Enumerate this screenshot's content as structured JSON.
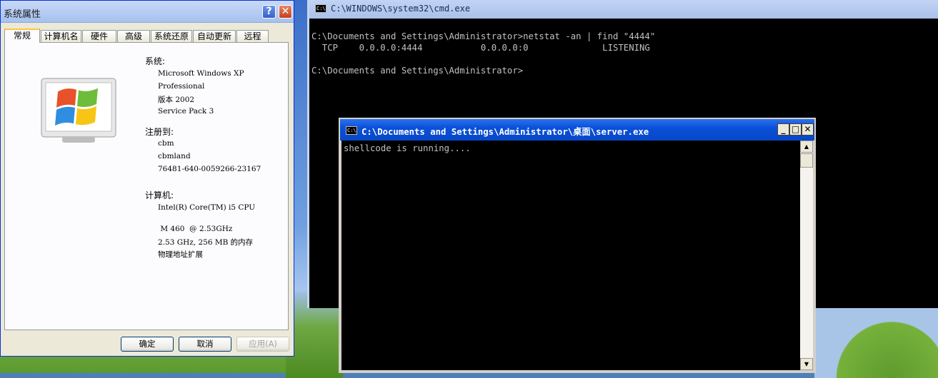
{
  "system_properties": {
    "title": "系统属性",
    "help_glyph": "?",
    "close_glyph": "✕",
    "tabs": [
      {
        "label": "常规",
        "active": true
      },
      {
        "label": "计算机名",
        "active": false
      },
      {
        "label": "硬件",
        "active": false
      },
      {
        "label": "高级",
        "active": false
      },
      {
        "label": "系统还原",
        "active": false
      },
      {
        "label": "自动更新",
        "active": false
      },
      {
        "label": "远程",
        "active": false
      }
    ],
    "system": {
      "heading": "系统:",
      "lines": [
        "Microsoft Windows XP",
        "Professional",
        "版本 2002",
        "Service Pack 3"
      ]
    },
    "registered": {
      "heading": "注册到:",
      "lines": [
        "cbm",
        "cbmland",
        "76481-640-0059266-23167"
      ]
    },
    "computer": {
      "heading": "计算机:",
      "lines": [
        "Intel(R) Core(TM) i5 CPU",
        " M 460  @ 2.53GHz",
        "2.53 GHz, 256 MB 的内存",
        "物理地址扩展"
      ]
    },
    "buttons": {
      "ok": "确定",
      "cancel": "取消",
      "apply": "应用(A)"
    }
  },
  "cmd_window": {
    "title": "C:\\WINDOWS\\system32\\cmd.exe",
    "icon_text": "C:\\",
    "lines": [
      "C:\\Documents and Settings\\Administrator>netstat -an | find \"4444\"",
      "  TCP    0.0.0.0:4444           0.0.0.0:0              LISTENING",
      "",
      "C:\\Documents and Settings\\Administrator>"
    ]
  },
  "server_window": {
    "title": "C:\\Documents and Settings\\Administrator\\桌面\\server.exe",
    "icon_text": "C:\\",
    "minimize_glyph": "_",
    "maximize_glyph": "□",
    "close_glyph": "✕",
    "output": "shellcode is running....",
    "scroll_up_glyph": "▲",
    "scroll_down_glyph": "▼"
  }
}
